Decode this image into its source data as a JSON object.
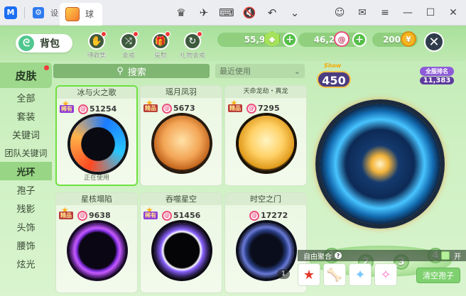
{
  "browser": {
    "tab1_short": "M",
    "tab2_short": "设",
    "tab3_short": "球"
  },
  "topbar": {
    "bag_label": "背包",
    "features": [
      {
        "label": "待收集",
        "icon": "hand-icon"
      },
      {
        "label": "合成",
        "icon": "merge-icon"
      },
      {
        "label": "奖励",
        "icon": "gift-icon"
      },
      {
        "label": "礼物合成",
        "icon": "gift-merge-icon"
      }
    ],
    "currency": [
      {
        "value": "55,929",
        "icon": "green-gem-icon",
        "color": "#9be34a"
      },
      {
        "value": "46,226",
        "icon": "spiral-coin-icon",
        "color": "#ec4f7e"
      },
      {
        "value": "200",
        "icon": "gold-coin-icon",
        "color": "#f6b620"
      }
    ]
  },
  "sidebar": {
    "title": "皮肤",
    "items": [
      "全部",
      "套装",
      "关键词",
      "团队关键词",
      "光环",
      "孢子",
      "残影",
      "头饰",
      "腰饰",
      "炫光"
    ],
    "active_index": 4
  },
  "search": {
    "label": "搜索"
  },
  "filter": {
    "label": "最近使用"
  },
  "cards": [
    {
      "title": "冰与火之歌",
      "rarity": "稀有",
      "price": "51254",
      "status": "正在使用",
      "selected": true
    },
    {
      "title": "瑶月凤羽",
      "rarity": "精品",
      "price": "5673",
      "status": "",
      "selected": false
    },
    {
      "title": "天命龙劫・真龙",
      "rarity": "精品",
      "price": "7295",
      "status": "",
      "selected": false
    },
    {
      "title": "星核塌陷",
      "rarity": "精品",
      "price": "9638",
      "status": "",
      "selected": false
    },
    {
      "title": "吞噬星空",
      "rarity": "稀有",
      "price": "51456",
      "status": "",
      "selected": false
    },
    {
      "title": "时空之门",
      "rarity": "",
      "price": "17272",
      "status": "",
      "selected": false
    }
  ],
  "preview": {
    "level_show": "Show",
    "level": "450",
    "server_rank_label": "全服排名",
    "server_rank_value": "11,383",
    "slots": [
      "1",
      "2",
      "3",
      "4"
    ],
    "scroll_count": "1"
  },
  "bottom": {
    "free_merge_label": "自由聚合",
    "help": "?",
    "toggle_label": "开",
    "clear_label": "清空孢子"
  }
}
